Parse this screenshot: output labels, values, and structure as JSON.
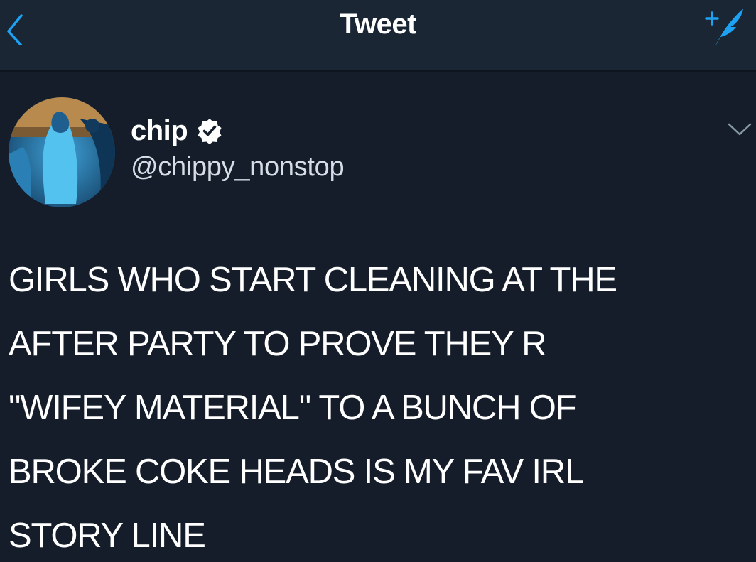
{
  "nav": {
    "title": "Tweet",
    "back_icon": "chevron-left-icon",
    "compose_icon": "compose-tweet-icon"
  },
  "tweet": {
    "author": {
      "display_name": "chip",
      "handle": "@chippy_nonstop",
      "verified": true,
      "avatar_icon": "avatar"
    },
    "menu_icon": "chevron-down-icon",
    "text_lines": [
      "GIRLS WHO START CLEANING AT THE",
      "AFTER PARTY TO PROVE THEY R",
      "\"WIFEY MATERIAL\" TO A BUNCH OF",
      "BROKE COKE HEADS IS MY FAV IRL",
      "STORY LINE"
    ]
  },
  "colors": {
    "background": "#141d29",
    "nav_background": "#1a2633",
    "accent": "#1da1f2",
    "text_primary": "#ffffff",
    "text_secondary": "#d6dde6"
  }
}
